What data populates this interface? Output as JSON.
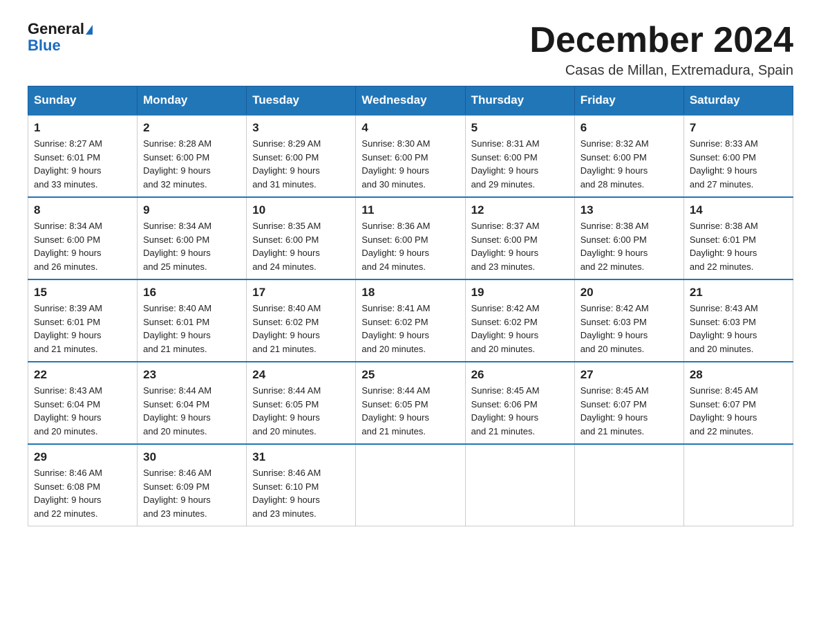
{
  "header": {
    "logo_line1": "General",
    "logo_line2": "Blue",
    "title": "December 2024",
    "subtitle": "Casas de Millan, Extremadura, Spain"
  },
  "days_of_week": [
    "Sunday",
    "Monday",
    "Tuesday",
    "Wednesday",
    "Thursday",
    "Friday",
    "Saturday"
  ],
  "weeks": [
    [
      {
        "day": "1",
        "sunrise": "8:27 AM",
        "sunset": "6:01 PM",
        "daylight": "9 hours and 33 minutes."
      },
      {
        "day": "2",
        "sunrise": "8:28 AM",
        "sunset": "6:00 PM",
        "daylight": "9 hours and 32 minutes."
      },
      {
        "day": "3",
        "sunrise": "8:29 AM",
        "sunset": "6:00 PM",
        "daylight": "9 hours and 31 minutes."
      },
      {
        "day": "4",
        "sunrise": "8:30 AM",
        "sunset": "6:00 PM",
        "daylight": "9 hours and 30 minutes."
      },
      {
        "day": "5",
        "sunrise": "8:31 AM",
        "sunset": "6:00 PM",
        "daylight": "9 hours and 29 minutes."
      },
      {
        "day": "6",
        "sunrise": "8:32 AM",
        "sunset": "6:00 PM",
        "daylight": "9 hours and 28 minutes."
      },
      {
        "day": "7",
        "sunrise": "8:33 AM",
        "sunset": "6:00 PM",
        "daylight": "9 hours and 27 minutes."
      }
    ],
    [
      {
        "day": "8",
        "sunrise": "8:34 AM",
        "sunset": "6:00 PM",
        "daylight": "9 hours and 26 minutes."
      },
      {
        "day": "9",
        "sunrise": "8:34 AM",
        "sunset": "6:00 PM",
        "daylight": "9 hours and 25 minutes."
      },
      {
        "day": "10",
        "sunrise": "8:35 AM",
        "sunset": "6:00 PM",
        "daylight": "9 hours and 24 minutes."
      },
      {
        "day": "11",
        "sunrise": "8:36 AM",
        "sunset": "6:00 PM",
        "daylight": "9 hours and 24 minutes."
      },
      {
        "day": "12",
        "sunrise": "8:37 AM",
        "sunset": "6:00 PM",
        "daylight": "9 hours and 23 minutes."
      },
      {
        "day": "13",
        "sunrise": "8:38 AM",
        "sunset": "6:00 PM",
        "daylight": "9 hours and 22 minutes."
      },
      {
        "day": "14",
        "sunrise": "8:38 AM",
        "sunset": "6:01 PM",
        "daylight": "9 hours and 22 minutes."
      }
    ],
    [
      {
        "day": "15",
        "sunrise": "8:39 AM",
        "sunset": "6:01 PM",
        "daylight": "9 hours and 21 minutes."
      },
      {
        "day": "16",
        "sunrise": "8:40 AM",
        "sunset": "6:01 PM",
        "daylight": "9 hours and 21 minutes."
      },
      {
        "day": "17",
        "sunrise": "8:40 AM",
        "sunset": "6:02 PM",
        "daylight": "9 hours and 21 minutes."
      },
      {
        "day": "18",
        "sunrise": "8:41 AM",
        "sunset": "6:02 PM",
        "daylight": "9 hours and 20 minutes."
      },
      {
        "day": "19",
        "sunrise": "8:42 AM",
        "sunset": "6:02 PM",
        "daylight": "9 hours and 20 minutes."
      },
      {
        "day": "20",
        "sunrise": "8:42 AM",
        "sunset": "6:03 PM",
        "daylight": "9 hours and 20 minutes."
      },
      {
        "day": "21",
        "sunrise": "8:43 AM",
        "sunset": "6:03 PM",
        "daylight": "9 hours and 20 minutes."
      }
    ],
    [
      {
        "day": "22",
        "sunrise": "8:43 AM",
        "sunset": "6:04 PM",
        "daylight": "9 hours and 20 minutes."
      },
      {
        "day": "23",
        "sunrise": "8:44 AM",
        "sunset": "6:04 PM",
        "daylight": "9 hours and 20 minutes."
      },
      {
        "day": "24",
        "sunrise": "8:44 AM",
        "sunset": "6:05 PM",
        "daylight": "9 hours and 20 minutes."
      },
      {
        "day": "25",
        "sunrise": "8:44 AM",
        "sunset": "6:05 PM",
        "daylight": "9 hours and 21 minutes."
      },
      {
        "day": "26",
        "sunrise": "8:45 AM",
        "sunset": "6:06 PM",
        "daylight": "9 hours and 21 minutes."
      },
      {
        "day": "27",
        "sunrise": "8:45 AM",
        "sunset": "6:07 PM",
        "daylight": "9 hours and 21 minutes."
      },
      {
        "day": "28",
        "sunrise": "8:45 AM",
        "sunset": "6:07 PM",
        "daylight": "9 hours and 22 minutes."
      }
    ],
    [
      {
        "day": "29",
        "sunrise": "8:46 AM",
        "sunset": "6:08 PM",
        "daylight": "9 hours and 22 minutes."
      },
      {
        "day": "30",
        "sunrise": "8:46 AM",
        "sunset": "6:09 PM",
        "daylight": "9 hours and 23 minutes."
      },
      {
        "day": "31",
        "sunrise": "8:46 AM",
        "sunset": "6:10 PM",
        "daylight": "9 hours and 23 minutes."
      },
      null,
      null,
      null,
      null
    ]
  ],
  "labels": {
    "sunrise": "Sunrise:",
    "sunset": "Sunset:",
    "daylight": "Daylight:"
  }
}
